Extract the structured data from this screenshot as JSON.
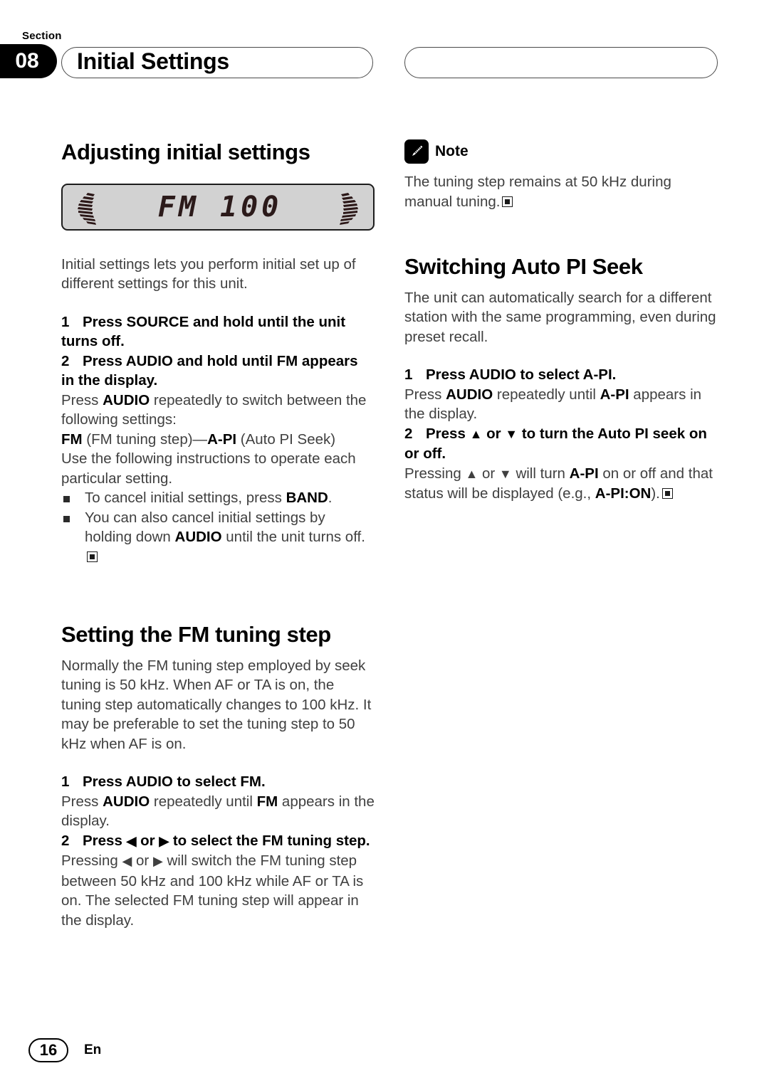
{
  "header": {
    "kicker": "Section",
    "section_number": "08",
    "title": "Initial Settings"
  },
  "left_column": {
    "heading": "Adjusting initial settings",
    "lcd": {
      "text": "FM 100",
      "bg_color": "#d2d2d2",
      "segment_color": "#2b1a1a",
      "left_arc_icon": "sound-arc-left-icon",
      "right_arc_icon": "sound-arc-right-icon"
    },
    "intro": "Initial settings lets you perform initial set up of different settings for this unit.",
    "step1_num": "1",
    "step1": "Press SOURCE and hold until the unit turns off.",
    "step2_num": "2",
    "step2": "Press AUDIO and hold until FM appears in the display.",
    "para_a_1": "Press ",
    "para_a_kw": "AUDIO",
    "para_a_2": " repeatedly to switch between the following settings:",
    "para_b_kw1": "FM",
    "para_b_1": " (FM tuning step)—",
    "para_b_kw2": "A-PI",
    "para_b_2": " (Auto PI Seek)",
    "para_c": "Use the following instructions to operate each particular setting.",
    "bullet1_1": "To cancel initial settings, press ",
    "bullet1_kw": "BAND",
    "bullet1_2": ".",
    "bullet2_1": "You can also cancel initial settings by holding down ",
    "bullet2_kw": "AUDIO",
    "bullet2_2": " until the unit turns off.",
    "heading2": "Setting the FM tuning step",
    "intro2": "Normally the FM tuning step employed by seek tuning is 50 kHz. When AF or TA is on, the tuning step automatically changes to 100 kHz. It may be preferable to set the tuning step to 50 kHz when AF is on.",
    "fm_step1_num": "1",
    "fm_step1": "Press AUDIO to select FM.",
    "fm_para1_1": "Press ",
    "fm_para1_kw1": "AUDIO",
    "fm_para1_2": " repeatedly until ",
    "fm_para1_kw2": "FM",
    "fm_para1_3": " appears in the display.",
    "fm_step2_num": "2",
    "fm_step2_a": "Press ",
    "fm_step2_left": "◀",
    "fm_step2_b": " or ",
    "fm_step2_right": "▶",
    "fm_step2_c": " to select the FM tuning step.",
    "fm_para2_a": "Pressing ",
    "fm_para2_left": "◀",
    "fm_para2_b": " or ",
    "fm_para2_right": "▶",
    "fm_para2_c": " will switch the FM tuning step between 50 kHz and 100 kHz while AF or TA is on. The selected FM tuning step will appear in the display."
  },
  "right_column": {
    "note_label": "Note",
    "note_icon": "pencil-icon",
    "note_text": "The tuning step remains at 50 kHz during manual tuning.",
    "heading": "Switching Auto PI Seek",
    "intro": "The unit can automatically search for a different station with the same programming, even during preset recall.",
    "step1_num": "1",
    "step1": "Press AUDIO to select A-PI.",
    "para1_1": "Press ",
    "para1_kw1": "AUDIO",
    "para1_2": " repeatedly until ",
    "para1_kw2": "A-PI",
    "para1_3": " appears in the display.",
    "step2_num": "2",
    "step2_a": "Press ",
    "step2_up": "▲",
    "step2_b": " or ",
    "step2_down": "▼",
    "step2_c": " to turn the Auto PI seek on or off.",
    "para2_a": "Pressing ",
    "para2_up": "▲",
    "para2_b": " or ",
    "para2_down": "▼",
    "para2_c": " will turn ",
    "para2_kw1": "A-PI",
    "para2_d": " on or off and that status will be displayed (e.g., ",
    "para2_kw2": "A-PI:ON",
    "para2_e": ")."
  },
  "footer": {
    "page_number": "16",
    "language": "En"
  }
}
